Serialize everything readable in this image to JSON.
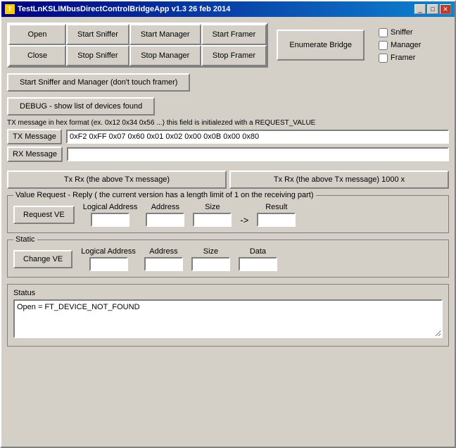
{
  "title": "TestLnKSLIMbusDirectControlBridgeApp  v1.3  26 feb 2014",
  "title_icon": "T",
  "buttons": {
    "open": "Open",
    "close": "Close",
    "start_sniffer": "Start Sniffer",
    "stop_sniffer": "Stop Sniffer",
    "start_manager": "Start Manager",
    "stop_manager": "Stop Manager",
    "start_framer": "Start Framer",
    "stop_framer": "Stop Framer",
    "enumerate_bridge": "Enumerate Bridge",
    "start_sniffer_manager": "Start Sniffer and Manager (don't touch framer)",
    "debug_devices": "DEBUG - show list of devices found",
    "tx_message": "TX Message",
    "rx_message": "RX Message",
    "tx_rx": "Tx  Rx (the above Tx message)",
    "tx_rx_1000": "Tx  Rx (the above Tx message) 1000 x",
    "request_ve": "Request VE",
    "change_ve": "Change VE"
  },
  "checkboxes": {
    "sniffer": {
      "label": "Sniffer",
      "checked": false
    },
    "manager": {
      "label": "Manager",
      "checked": false
    },
    "framer": {
      "label": "Framer",
      "checked": false
    }
  },
  "tx_hint": "TX message in hex format (ex. 0x12 0x34 0x56 ...) this field is initialezed with a REQUEST_VALUE",
  "tx_value": "0xF2 0xFF 0x07 0x60 0x01 0x02 0x00 0x0B 0x00 0x80",
  "rx_value": "",
  "value_request_section": {
    "title": "Value Request - Reply  ( the current version has a length limit of 1 on the receiving part)",
    "logical_address_label": "Logical Address",
    "address_label": "Address",
    "size_label": "Size",
    "result_label": "Result",
    "logical_address_value": "",
    "address_value": "",
    "size_value": "",
    "result_value": ""
  },
  "static_section": {
    "title": "Static",
    "logical_address_label": "Logical Address",
    "address_label": "Address",
    "size_label": "Size",
    "data_label": "Data",
    "logical_address_value": "",
    "address_value": "",
    "size_value": "",
    "data_value": ""
  },
  "status": {
    "label": "Status",
    "value": "Open = FT_DEVICE_NOT_FOUND"
  },
  "arrow": "->",
  "title_bar_buttons": {
    "minimize": "_",
    "maximize": "□",
    "close": "✕"
  }
}
